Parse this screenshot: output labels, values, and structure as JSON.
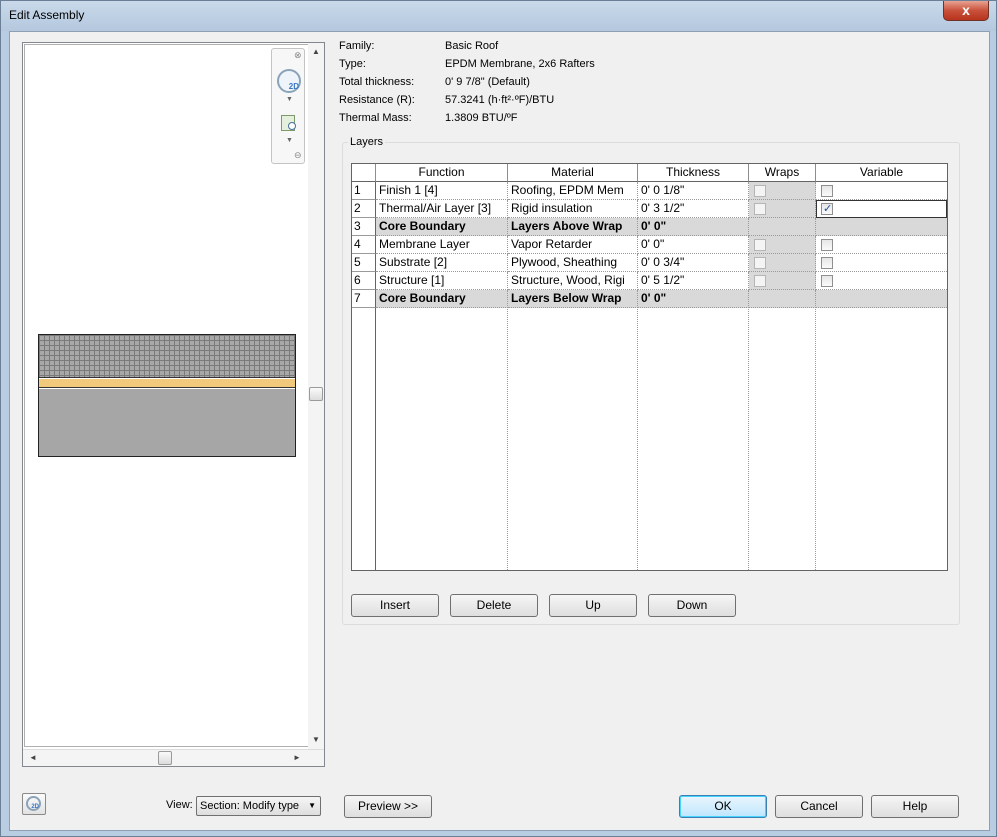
{
  "window": {
    "title": "Edit Assembly",
    "close_glyph": "x"
  },
  "info": [
    {
      "label": "Family:",
      "value": "Basic Roof"
    },
    {
      "label": "Type:",
      "value": "EPDM Membrane, 2x6 Rafters"
    },
    {
      "label": "Total thickness:",
      "value": "0'  9 7/8\" (Default)"
    },
    {
      "label": "Resistance (R):",
      "value": "57.3241 (h·ft²·ºF)/BTU"
    },
    {
      "label": "Thermal Mass:",
      "value": "1.3809 BTU/ºF"
    }
  ],
  "layers": {
    "group_label": "Layers",
    "columns": [
      "Function",
      "Material",
      "Thickness",
      "Wraps",
      "Variable"
    ],
    "rows": [
      {
        "num": "1",
        "function": "Finish 1 [4]",
        "material": "Roofing, EPDM Mem",
        "thickness": "0'  0 1/8\"",
        "wraps": false,
        "variable": false,
        "core": false
      },
      {
        "num": "2",
        "function": "Thermal/Air Layer [3]",
        "material": "Rigid insulation",
        "thickness": "0'  3 1/2\"",
        "wraps": false,
        "variable": true,
        "core": false
      },
      {
        "num": "3",
        "function": "Core Boundary",
        "material": "Layers Above Wrap",
        "thickness": "0'  0\"",
        "core": true
      },
      {
        "num": "4",
        "function": "Membrane Layer",
        "material": "Vapor Retarder",
        "thickness": "0'  0\"",
        "wraps": false,
        "variable": false,
        "core": false
      },
      {
        "num": "5",
        "function": "Substrate [2]",
        "material": "Plywood, Sheathing",
        "thickness": "0'  0 3/4\"",
        "wraps": false,
        "variable": false,
        "core": false
      },
      {
        "num": "6",
        "function": "Structure [1]",
        "material": "Structure, Wood, Rigi",
        "thickness": "0'  5 1/2\"",
        "wraps": false,
        "variable": false,
        "core": false
      },
      {
        "num": "7",
        "function": "Core Boundary",
        "material": "Layers Below Wrap",
        "thickness": "0'  0\"",
        "core": true
      }
    ]
  },
  "layer_buttons": {
    "insert": "Insert",
    "delete": "Delete",
    "up": "Up",
    "down": "Down"
  },
  "preview_nav": {
    "view_2d_label": "2D"
  },
  "bottom": {
    "view_label": "View:",
    "view_value": "Section: Modify type",
    "preview_button": "Preview >>",
    "ok": "OK",
    "cancel": "Cancel",
    "help": "Help"
  }
}
